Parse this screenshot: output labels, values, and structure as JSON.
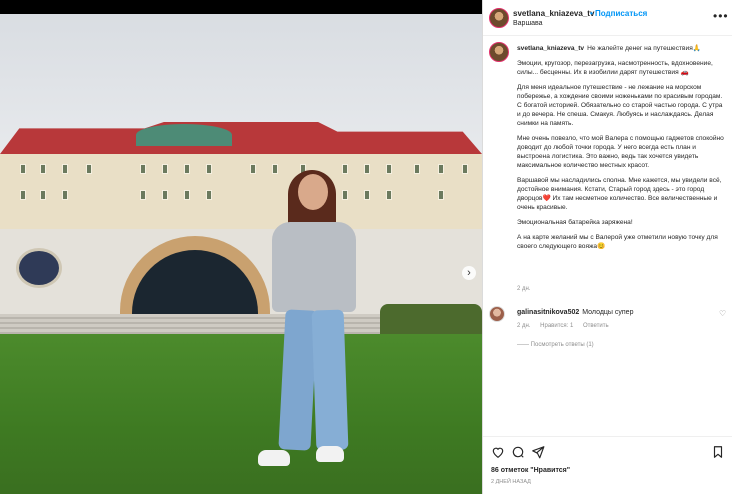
{
  "post": {
    "username": "svetlana_kniazeva_tv",
    "follow_label": "• Подписаться",
    "location": "Варшава",
    "caption_user": "svetlana_kniazeva_tv",
    "caption_paragraphs": [
      "Не жалейте денег на путешествия🙏",
      "Эмоции, кругозор, перезагрузка, насмотренность, вдохновение, силы... бесценны. Их в изобилии дарят путешествия 🚗",
      "Для меня идеальное путешествие - не лежание на морском побережье, а хождение своими ноженьками по красивым городам. С богатой историей. Обязательно со старой частью города. С утра и до вечера. Не спеша. Смакуя. Любуясь и наслаждаясь. Делая снимки на память.",
      "Мне очень повезло, что мой Валера с помощью гаджетов спокойно доводит до любой точки города. У него всегда есть план и выстроена логистика. Это важно, ведь так хочется увидеть максимальное количество местных красот.",
      "Варшавой мы насладились сполна. Мне кажется, мы увидели всё, достойное внимания. Кстати, Старый город здесь - это город дворцов❤️ Их там несметное количество. Все величественные и очень красивые.",
      "Эмоциональная батарейка заряжена!",
      "А на карте желаний мы с Валерой уже отметили новую точку для своего следующего вояжа😊"
    ],
    "caption_time": "2 дн.",
    "likes": "86 отметок \"Нравится\"",
    "date": "2 дней назад"
  },
  "comment": {
    "user": "galinasitnikova502",
    "text": "Молодцы супер",
    "time": "2 дн.",
    "likes": "Нравится: 1",
    "reply": "Ответить",
    "view_replies": "—— Посмотреть ответы (1)"
  },
  "icons": [
    "more-options-icon",
    "heart-icon",
    "comment-icon",
    "share-icon",
    "bookmark-icon",
    "chevron-right-icon"
  ],
  "colors": {
    "follow": "#0095f6",
    "lawn": "#3e7a22",
    "roof": "#b8383a"
  }
}
